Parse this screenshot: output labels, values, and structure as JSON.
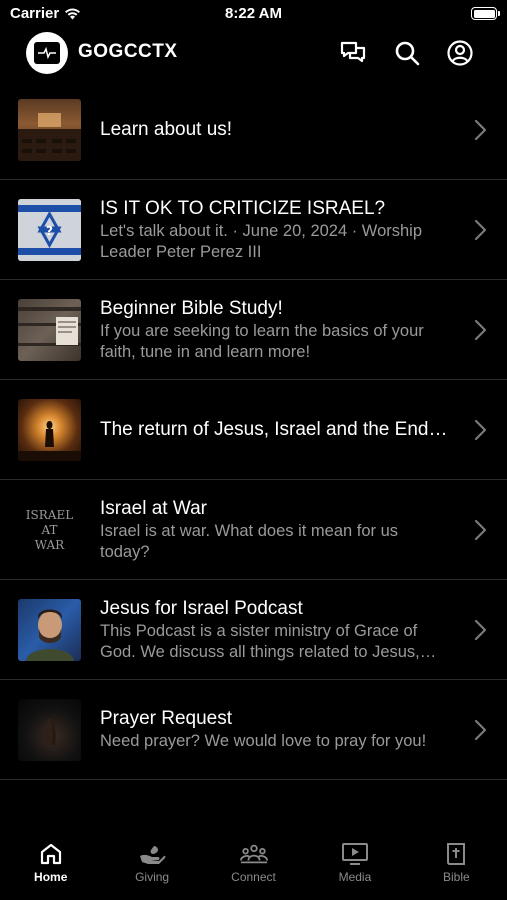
{
  "status_bar": {
    "carrier": "Carrier",
    "time": "8:22 AM"
  },
  "header": {
    "title": "GOGCCTX",
    "icons": [
      "chat-icon",
      "search-icon",
      "account-icon"
    ]
  },
  "items": [
    {
      "title": "Learn about us!",
      "subtitle": "",
      "thumb": "church-interior"
    },
    {
      "title": "IS IT OK TO CRITICIZE ISRAEL?",
      "subtitle": "Let's talk about it. · June 20, 2024 · Worship Leader Peter Perez III",
      "thumb": "israel-flag"
    },
    {
      "title": "Beginner Bible Study!",
      "subtitle": "If you are seeking to learn the basics of your faith, tune in and learn more!",
      "thumb": "bible-wood"
    },
    {
      "title": "The return of Jesus, Israel and the End Times",
      "subtitle": "",
      "thumb": "glowing-figure"
    },
    {
      "title": "Israel at War",
      "subtitle": "Israel is at war. What does it mean for us today?",
      "thumb": "israel-at-war",
      "thumb_text": [
        "ISRAEL",
        "AT",
        "WAR"
      ]
    },
    {
      "title": "Jesus for Israel Podcast",
      "subtitle": "This Podcast is a sister ministry of Grace of God. We discuss all things related to Jesus, Israel and the Bible.",
      "thumb": "podcast-host"
    },
    {
      "title": "Prayer Request",
      "subtitle": "Need prayer? We would love to pray for you!",
      "thumb": "praying-hands"
    }
  ],
  "tabs": [
    {
      "label": "Home",
      "icon": "home-icon",
      "active": true
    },
    {
      "label": "Giving",
      "icon": "giving-icon",
      "active": false
    },
    {
      "label": "Connect",
      "icon": "connect-icon",
      "active": false
    },
    {
      "label": "Media",
      "icon": "media-icon",
      "active": false
    },
    {
      "label": "Bible",
      "icon": "bible-icon",
      "active": false
    }
  ],
  "colors": {
    "background": "#000000",
    "text": "#ffffff",
    "subtext": "#9a9a9a",
    "divider": "#2a2a2a",
    "tab_inactive": "#8a8a8a"
  }
}
